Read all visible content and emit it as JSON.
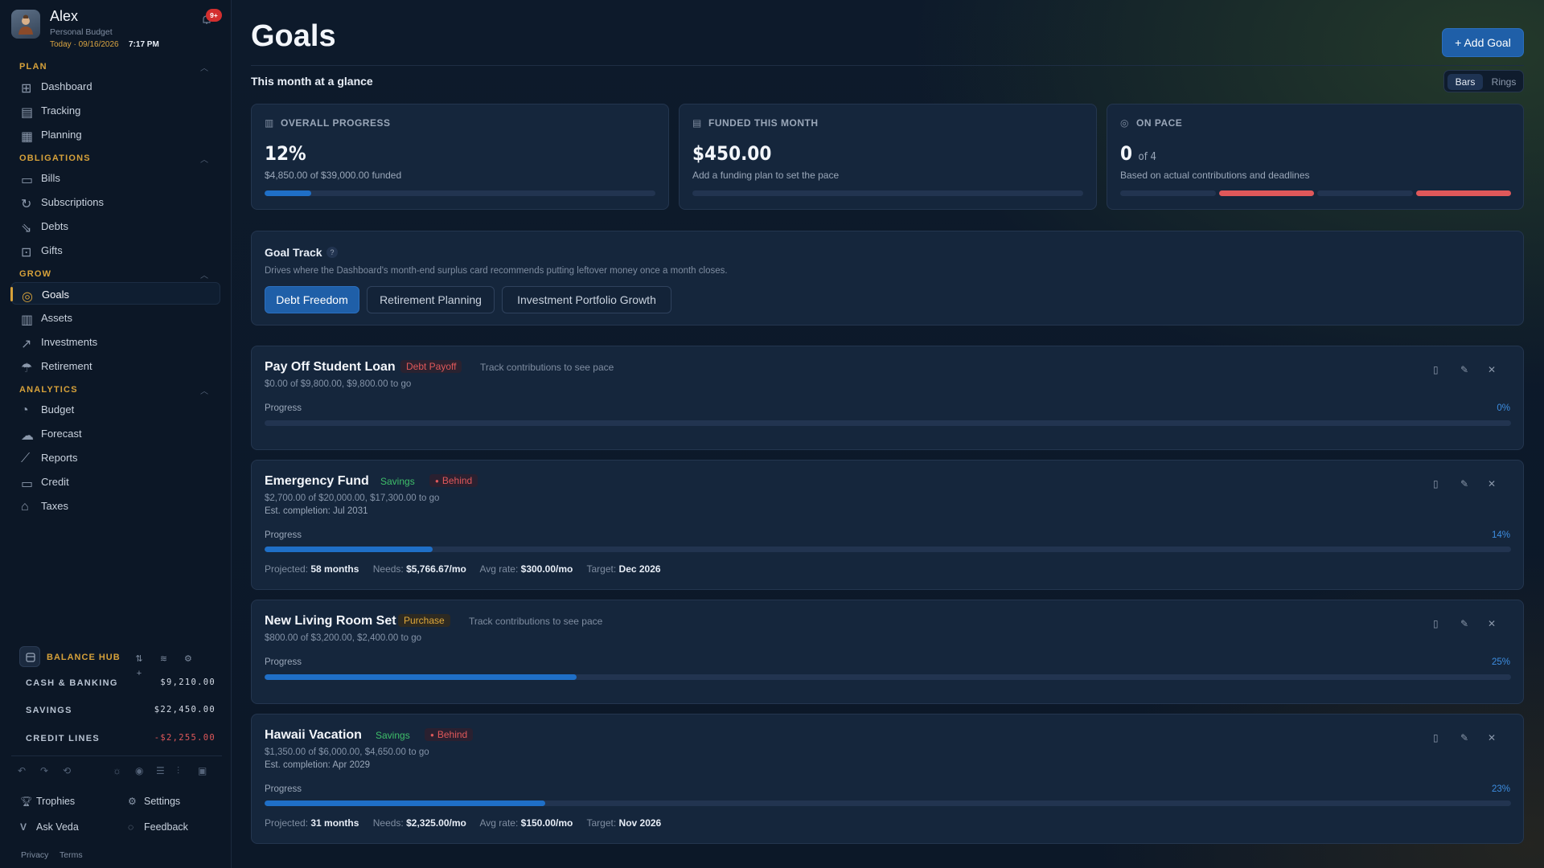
{
  "profile": {
    "name": "Alex",
    "subtitle": "Personal Budget",
    "date": "Today · 09/16/2026",
    "time": "7:17 PM",
    "notifications": "9+"
  },
  "sidebar": {
    "sections": [
      {
        "title": "PLAN",
        "items": [
          {
            "label": "Dashboard",
            "icon": "grid-icon"
          },
          {
            "label": "Tracking",
            "icon": "receipt-icon"
          },
          {
            "label": "Planning",
            "icon": "calendar-icon"
          }
        ]
      },
      {
        "title": "OBLIGATIONS",
        "items": [
          {
            "label": "Bills",
            "icon": "wallet-icon"
          },
          {
            "label": "Subscriptions",
            "icon": "refresh-icon"
          },
          {
            "label": "Debts",
            "icon": "chart-down-icon"
          },
          {
            "label": "Gifts",
            "icon": "gift-icon"
          }
        ]
      },
      {
        "title": "GROW",
        "items": [
          {
            "label": "Goals",
            "icon": "target-icon",
            "active": true
          },
          {
            "label": "Assets",
            "icon": "building-icon"
          },
          {
            "label": "Investments",
            "icon": "trend-up-icon"
          },
          {
            "label": "Retirement",
            "icon": "umbrella-icon"
          }
        ]
      },
      {
        "title": "ANALYTICS",
        "items": [
          {
            "label": "Budget",
            "icon": "pie-icon"
          },
          {
            "label": "Forecast",
            "icon": "cloud-icon"
          },
          {
            "label": "Reports",
            "icon": "line-chart-icon"
          },
          {
            "label": "Credit",
            "icon": "card-icon"
          },
          {
            "label": "Taxes",
            "icon": "bank-icon"
          }
        ]
      }
    ]
  },
  "balance_hub": {
    "title": "BALANCE HUB",
    "rows": [
      {
        "name": "CASH & BANKING",
        "amount": "$9,210.00"
      },
      {
        "name": "SAVINGS",
        "amount": "$22,450.00"
      },
      {
        "name": "CREDIT LINES",
        "amount": "-$2,255.00"
      }
    ]
  },
  "footer": {
    "trophies": "Trophies",
    "settings": "Settings",
    "ask_veda": "Ask Veda",
    "feedback": "Feedback",
    "privacy": "Privacy",
    "terms": "Terms"
  },
  "header": {
    "title": "Goals",
    "add_goal": "+ Add Goal",
    "glance": "This month at a glance",
    "view_options": [
      "Bars",
      "Rings"
    ],
    "selected_view": "Bars"
  },
  "stats": [
    {
      "label": "OVERALL PROGRESS",
      "value": "12%",
      "suffix": "",
      "sub": "$4,850.00 of $39,000.00 funded",
      "progress": 0.12,
      "icon": "bar-chart-icon"
    },
    {
      "label": "FUNDED THIS MONTH",
      "value": "$450.00",
      "suffix": "",
      "sub": "Add a funding plan to set the pace",
      "progress": 0,
      "icon": "calendar-icon"
    },
    {
      "label": "ON PACE",
      "value": "0",
      "suffix": "of 4",
      "sub": "Based on actual contributions and deadlines",
      "segments": [
        "empty",
        "red",
        "empty",
        "red"
      ],
      "icon": "check-circle-icon"
    }
  ],
  "goal_track": {
    "title": "Goal Track",
    "help": "?",
    "description": "Drives where the Dashboard's month-end surplus card recommends putting leftover money once a month closes.",
    "options": [
      "Debt Freedom",
      "Retirement Planning",
      "Investment Portfolio Growth"
    ],
    "selected": "Debt Freedom"
  },
  "goals": [
    {
      "name": "Pay Off Student Loan",
      "category": "Debt Payoff",
      "status": "",
      "pace_note": "Track contributions to see pace",
      "amount_text": "$0.00 of $9,800.00, $9,800.00 to go",
      "est_completion": "",
      "progress_label": "Progress",
      "progress_pct": "0%",
      "progress": 0.0,
      "meta": null
    },
    {
      "name": "Emergency Fund",
      "category": "Savings",
      "status": "Behind",
      "pace_note": "",
      "amount_text": "$2,700.00 of $20,000.00, $17,300.00 to go",
      "est_completion": "Est. completion: Jul 2031",
      "progress_label": "Progress",
      "progress_pct": "14%",
      "progress": 0.135,
      "meta": {
        "projected_label": "Projected:",
        "projected": "58 months",
        "needs_label": "Needs:",
        "needs": "$5,766.67/mo",
        "avg_label": "Avg rate:",
        "avg": "$300.00/mo",
        "target_label": "Target:",
        "target": "Dec 2026"
      }
    },
    {
      "name": "New Living Room Set",
      "category": "Purchase",
      "status": "",
      "pace_note": "Track contributions to see pace",
      "amount_text": "$800.00 of $3,200.00, $2,400.00 to go",
      "est_completion": "",
      "progress_label": "Progress",
      "progress_pct": "25%",
      "progress": 0.25,
      "meta": null
    },
    {
      "name": "Hawaii Vacation",
      "category": "Savings",
      "status": "Behind",
      "pace_note": "",
      "amount_text": "$1,350.00 of $6,000.00, $4,650.00 to go",
      "est_completion": "Est. completion: Apr 2029",
      "progress_label": "Progress",
      "progress_pct": "23%",
      "progress": 0.225,
      "meta": {
        "projected_label": "Projected:",
        "projected": "31 months",
        "needs_label": "Needs:",
        "needs": "$2,325.00/mo",
        "avg_label": "Avg rate:",
        "avg": "$150.00/mo",
        "target_label": "Target:",
        "target": "Nov 2026"
      }
    }
  ],
  "colors": {
    "accent": "#1f5fa8",
    "gold": "#d6a13a",
    "danger": "#e0585a",
    "success": "#3fbf6a"
  }
}
